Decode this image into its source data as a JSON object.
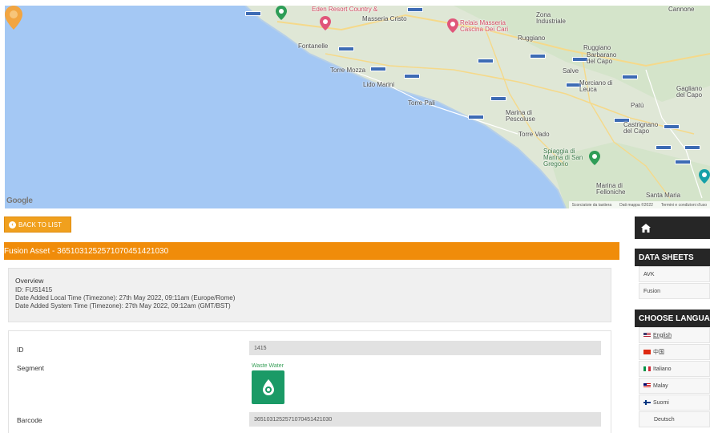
{
  "map": {
    "google": "Google",
    "footer": [
      "Scorciatoie da tastiera",
      "Dati mappa ©2022",
      "Termini e condizioni d'uso"
    ],
    "labels": [
      {
        "text": "Eden Resort Country &",
        "kind": "poi"
      },
      {
        "text": "Masseria Cristo",
        "kind": "town"
      },
      {
        "text": "Relais Masseria Cascina Dei Cari",
        "kind": "poi"
      },
      {
        "text": "Zona Industriale",
        "kind": "town"
      },
      {
        "text": "Cannone",
        "kind": "town"
      },
      {
        "text": "Ruggiano",
        "kind": "town"
      },
      {
        "text": "Ruggiano",
        "kind": "town"
      },
      {
        "text": "Barbarano del Capo",
        "kind": "town"
      },
      {
        "text": "Fontanelle",
        "kind": "town"
      },
      {
        "text": "Torre Mozza",
        "kind": "town"
      },
      {
        "text": "Lido Marini",
        "kind": "town"
      },
      {
        "text": "Salve",
        "kind": "town"
      },
      {
        "text": "Morciano di Leuca",
        "kind": "town"
      },
      {
        "text": "Gagliano del Capo",
        "kind": "town"
      },
      {
        "text": "Torre Pali",
        "kind": "town"
      },
      {
        "text": "Patù",
        "kind": "town"
      },
      {
        "text": "Marina di Pescoluse",
        "kind": "town"
      },
      {
        "text": "Castrignano del Capo",
        "kind": "town"
      },
      {
        "text": "Torre Vado",
        "kind": "town"
      },
      {
        "text": "Spiaggia di Marina di San Gregorio",
        "kind": "sea"
      },
      {
        "text": "Marina di Felloniche",
        "kind": "town"
      },
      {
        "text": "Santa Maria",
        "kind": "town"
      }
    ]
  },
  "back_button": {
    "label": "BACK TO LIST"
  },
  "title_bar": {
    "text": "Fusion Asset - 3651031252571070451421030"
  },
  "overview": {
    "title": "Overview",
    "lines": [
      "ID: FUS1415",
      "Date Added Local Time (Timezone): 27th May 2022, 09:11am (Europe/Rome)",
      "Date Added System Time (Timezone): 27th May 2022, 09:12am (GMT/BST)"
    ]
  },
  "fields": {
    "id_label": "ID",
    "id_value": "1415",
    "segment_label": "Segment",
    "segment_link": "Waste Water",
    "barcode_label": "Barcode",
    "barcode_value": "3651031252571070451421030"
  },
  "sidebar": {
    "data_sheets_heading": "DATA SHEETS",
    "data_sheets": [
      "AVK",
      "Fusion"
    ],
    "language_heading": "CHOOSE LANGUAGE",
    "languages": [
      {
        "label": "English",
        "flag": "en"
      },
      {
        "label": "中国",
        "flag": "cn"
      },
      {
        "label": "Italiano",
        "flag": "it"
      },
      {
        "label": "Malay",
        "flag": "my"
      },
      {
        "label": "Suomi",
        "flag": "fi"
      },
      {
        "label": "Deutsch",
        "flag": "none"
      }
    ]
  },
  "colors": {
    "accent_orange": "#f08c0a",
    "sidebar_dark": "#262626",
    "segment_green": "#1a9a66"
  }
}
